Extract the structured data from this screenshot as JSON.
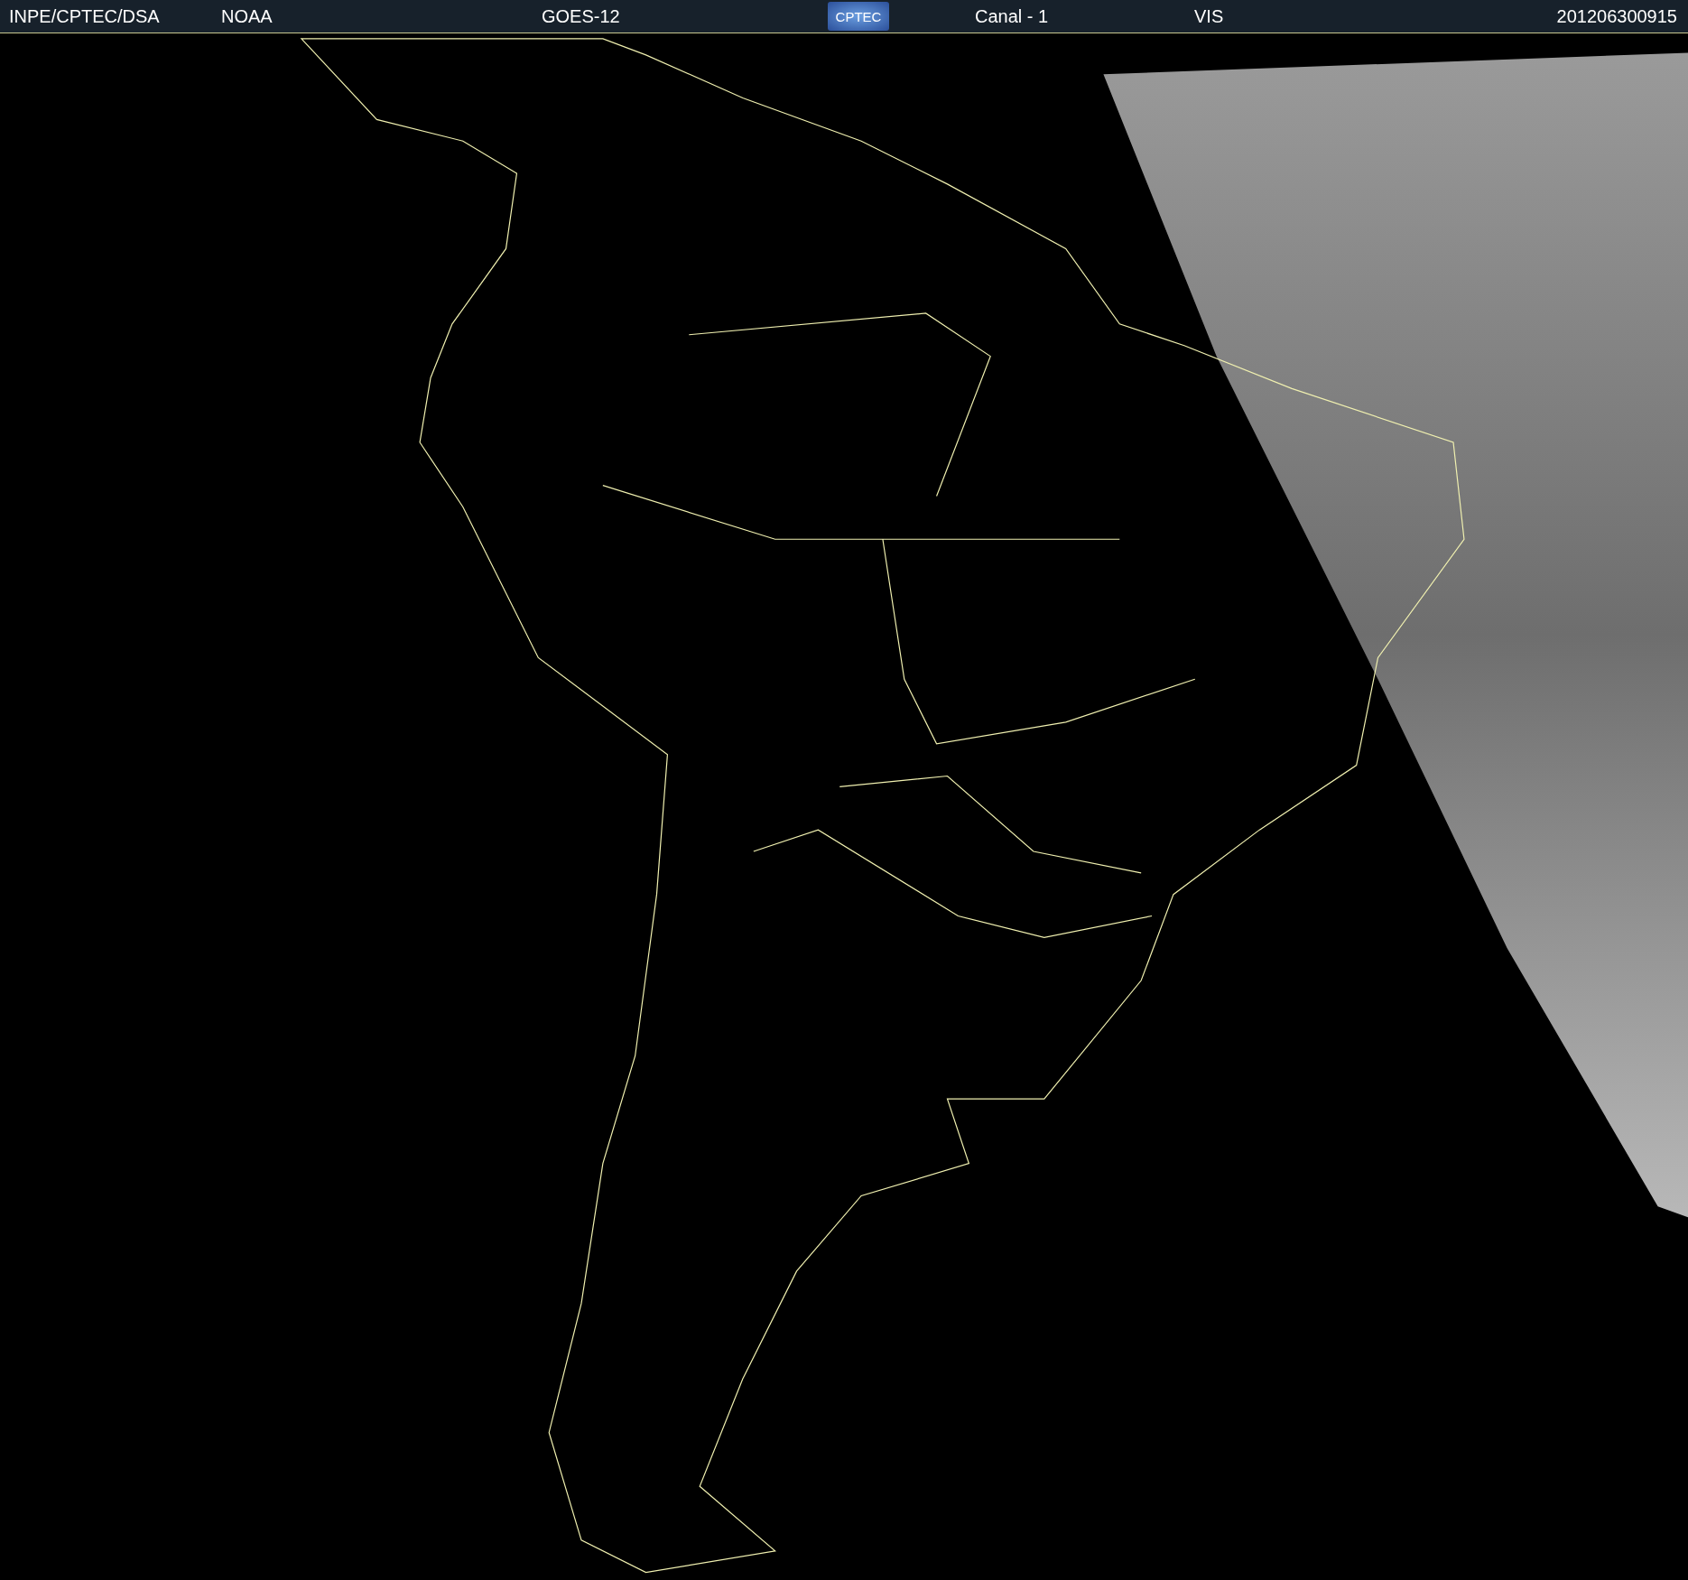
{
  "header": {
    "source": "INPE/CPTEC/DSA",
    "agency": "NOAA",
    "satellite": "GOES-12",
    "logo": "CPTEC",
    "channel": "Canal - 1",
    "band": "VIS",
    "timestamp": "201206300915"
  }
}
